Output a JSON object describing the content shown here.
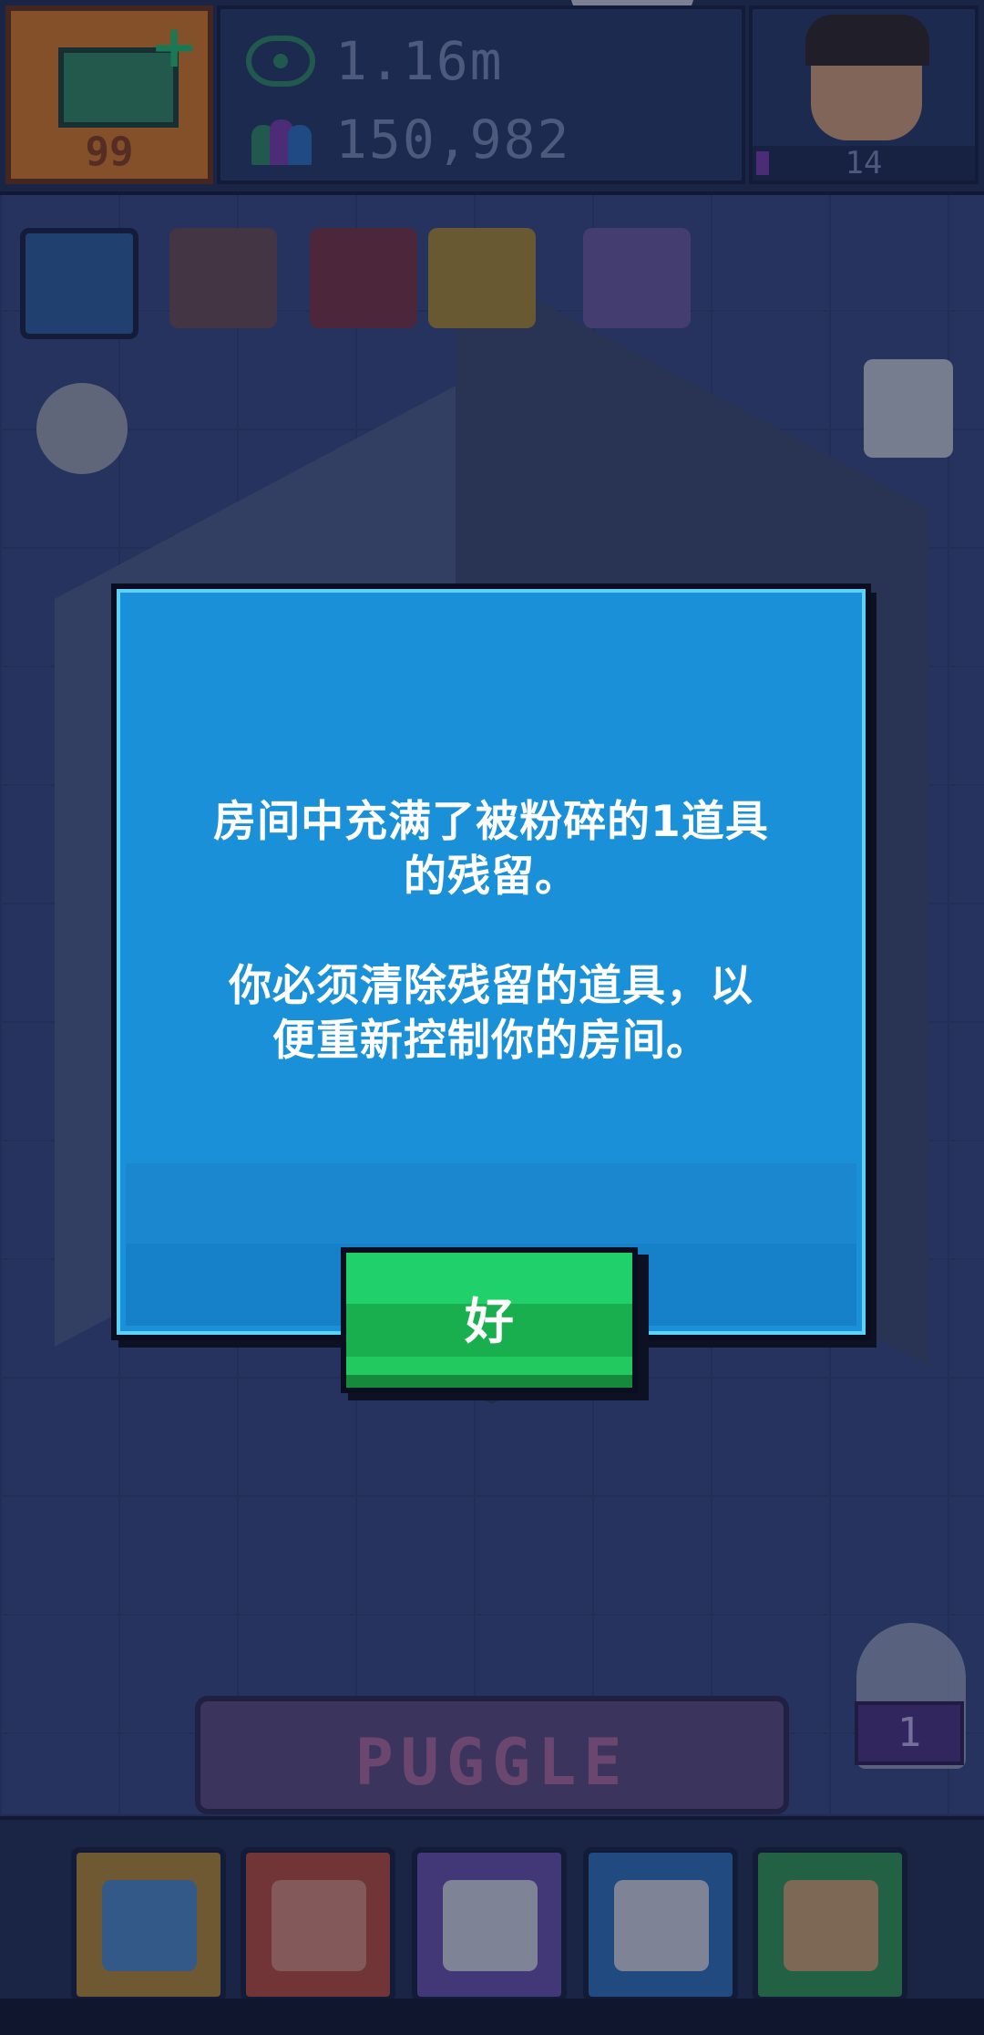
{
  "hud": {
    "cash_count": "99",
    "views": "1.16m",
    "followers": "150,982",
    "level": "14"
  },
  "dialog": {
    "message": "房间中充满了被粉碎的1道具\n的残留。\n\n你必须清除残留的道具，以\n便重新控制你的房间。",
    "ok_label": "好"
  },
  "puggle": {
    "title": "PUGGLE"
  },
  "ghost_badge": "1",
  "colors": {
    "dialog_bg": "#1a90d9",
    "dialog_border": "#5dd2f7",
    "ok_button": "#20d06a",
    "overlay": "#141c3c"
  },
  "icons": [
    "money-plus-icon",
    "eye-icon",
    "people-icon",
    "menu-icon",
    "box-icon",
    "room-icon",
    "trophy-icon",
    "music-icon",
    "gear-icon",
    "gameboy-icon",
    "computer-icon",
    "brain-upgrade-icon",
    "panda-icon",
    "people-chat-icon",
    "map-icon"
  ]
}
